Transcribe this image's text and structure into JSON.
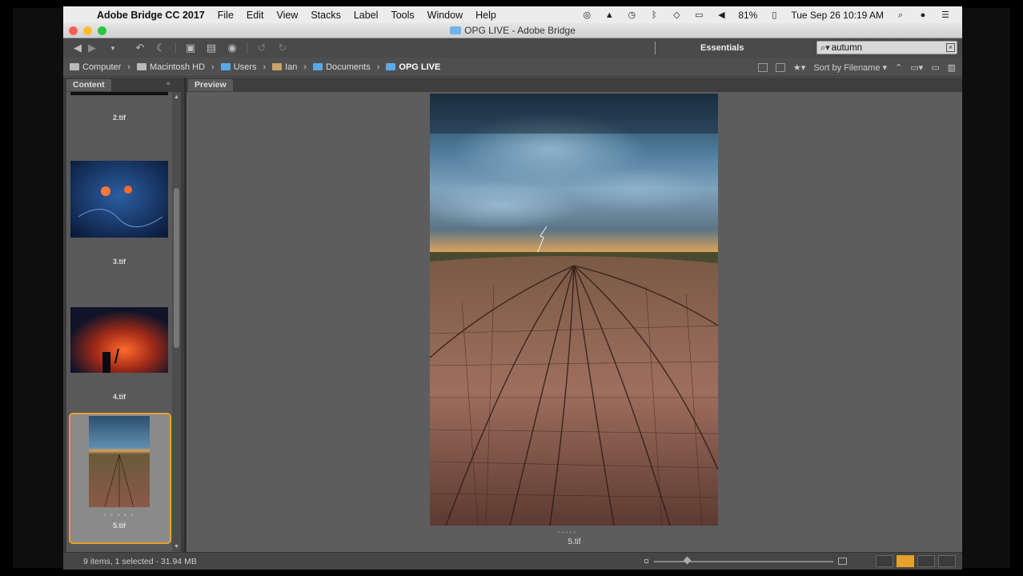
{
  "menubar": {
    "app_name": "Adobe Bridge CC 2017",
    "menus": [
      "File",
      "Edit",
      "View",
      "Stacks",
      "Label",
      "Tools",
      "Window",
      "Help"
    ],
    "battery": "81%",
    "clock": "Tue Sep 26  10:19 AM"
  },
  "window": {
    "title": "OPG LIVE - Adobe Bridge"
  },
  "toolbar": {
    "workspace": "Essentials",
    "search_value": "autumn"
  },
  "pathbar": {
    "crumbs": [
      "Computer",
      "Macintosh HD",
      "Users",
      "Ian",
      "Documents",
      "OPG LIVE"
    ],
    "sort_label": "Sort by Filename"
  },
  "content_panel": {
    "tab": "Content",
    "items": [
      {
        "name": "2.tif"
      },
      {
        "name": "3.tif"
      },
      {
        "name": "4.tif"
      },
      {
        "name": "5.tif",
        "selected": true
      }
    ]
  },
  "preview_panel": {
    "tab": "Preview",
    "filename": "5.tif"
  },
  "statusbar": {
    "summary": "9 items, 1 selected - 31.94 MB"
  },
  "colors": {
    "selection_accent": "#e6a12b",
    "panel_bg": "#595959"
  }
}
